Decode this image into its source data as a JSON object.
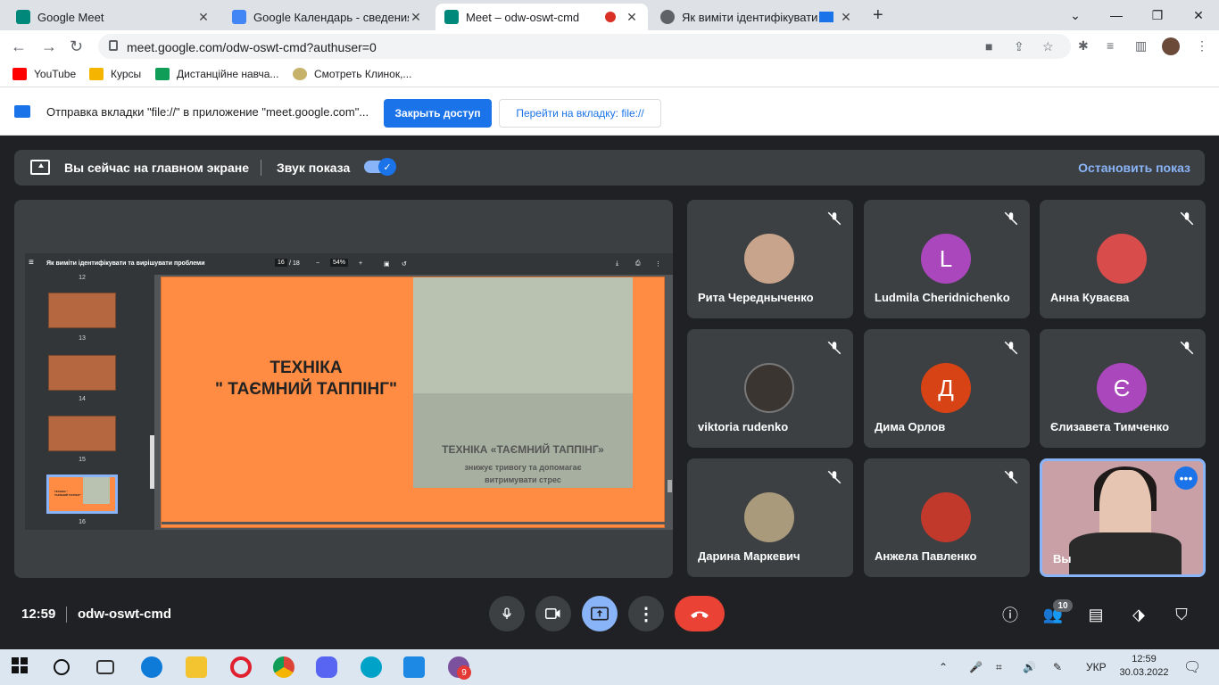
{
  "browser": {
    "tabs": [
      {
        "label": "Google Meet",
        "color": "#00897b"
      },
      {
        "label": "Google Календарь - сведения о",
        "color": "#4285f4"
      },
      {
        "label": "Meet – odw-oswt-cmd",
        "color": "#00897b"
      },
      {
        "label": "Як виміти ідентифікувати та",
        "color": "#5f6368"
      }
    ],
    "url": "meet.google.com/odw-oswt-cmd?authuser=0",
    "bookmarks": [
      {
        "label": "YouTube",
        "color": "#ff0000"
      },
      {
        "label": "Курсы",
        "color": "#f4b400"
      },
      {
        "label": "Дистанційне навча...",
        "color": "#0f9d58"
      },
      {
        "label": "Смотреть Клинок,...",
        "color": "#c7b26a"
      }
    ]
  },
  "infobar": {
    "message": "Отправка вкладки \"file://\" в приложение \"meet.google.com\"...",
    "close_access": "Закрыть доступ",
    "go_to_tab": "Перейти на вкладку: file://"
  },
  "presentation_bar": {
    "status": "Вы сейчас на главном экране",
    "sound_label": "Звук показа",
    "sound_on": true,
    "stop_label": "Остановить показ"
  },
  "pdf": {
    "doc_title": "Як виміти ідентифікувати та вирішувати проблеми",
    "page": "16",
    "total": "18",
    "zoom": "54%",
    "thumbnails": [
      "12",
      "13",
      "14",
      "15",
      "16"
    ],
    "slide_title_1": "ТЕХНІКА",
    "slide_title_2": "\" ТАЄМНИЙ ТАППІНГ\"",
    "panel_title": "ТЕХНІКА «ТАЄМНИЙ ТАППІНГ»",
    "panel_sub_1": "знижує тривогу та допомагає",
    "panel_sub_2": "витримувати стрес",
    "thumb_title": "ТЕХНІКА \" ТАЄМНИЙ ТАППІНГ\""
  },
  "participants": [
    {
      "name": "Рита Чередныченко",
      "initial": "",
      "color": "#c9a48c"
    },
    {
      "name": "Ludmila Cheridnichenko",
      "initial": "L",
      "color": "#ab47bc"
    },
    {
      "name": "Анна Куваєва",
      "initial": "",
      "color": "#d94c4c"
    },
    {
      "name": "viktoria rudenko",
      "initial": "",
      "color": "#3a3530"
    },
    {
      "name": "Дима Орлов",
      "initial": "Д",
      "color": "#d84315"
    },
    {
      "name": "Єлизавета Тимченко",
      "initial": "Є",
      "color": "#ab47bc"
    },
    {
      "name": "Дарина Маркевич",
      "initial": "",
      "color": "#a89a7a"
    },
    {
      "name": "Анжела Павленко",
      "initial": "",
      "color": "#c0392b"
    },
    {
      "name": "Вы",
      "initial": "",
      "color": "#c9a0a5"
    }
  ],
  "meeting": {
    "time": "12:59",
    "code": "odw-oswt-cmd",
    "people_count": "10"
  },
  "taskbar": {
    "lang": "УКР",
    "time": "12:59",
    "date": "30.03.2022",
    "viber_badge": "9"
  }
}
